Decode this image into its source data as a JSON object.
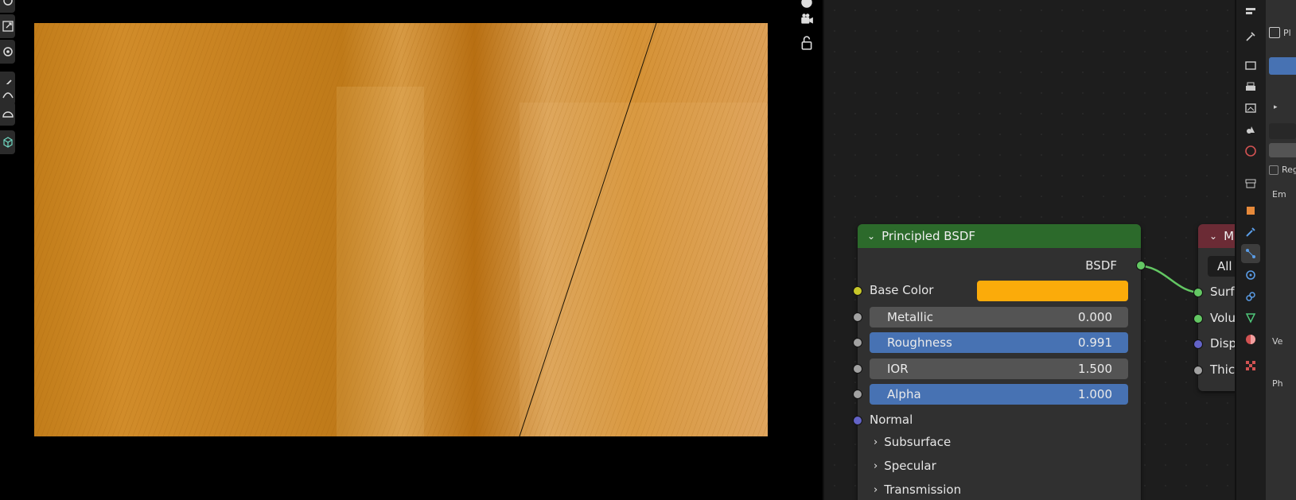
{
  "node_editor": {
    "principled_node": {
      "title": "Principled BSDF",
      "output_label": "BSDF",
      "base_color_label": "Base Color",
      "base_color_value": "#fbab0a",
      "fields": [
        {
          "label": "Metallic",
          "value": "0.000",
          "style": "gray"
        },
        {
          "label": "Roughness",
          "value": "0.991",
          "style": "blue"
        },
        {
          "label": "IOR",
          "value": "1.500",
          "style": "gray"
        },
        {
          "label": "Alpha",
          "value": "1.000",
          "style": "blue"
        }
      ],
      "normal_label": "Normal",
      "panels": [
        "Subsurface",
        "Specular",
        "Transmission"
      ]
    },
    "output_node": {
      "title": "M",
      "select_value": "All",
      "inputs": [
        "Surfa",
        "Volu",
        "Disp",
        "Thic"
      ]
    }
  },
  "properties": {
    "header_text": "Pl",
    "text_reg": "Reg",
    "text_em": "Em",
    "text_ve": "Ve",
    "text_ph": "Ph"
  }
}
